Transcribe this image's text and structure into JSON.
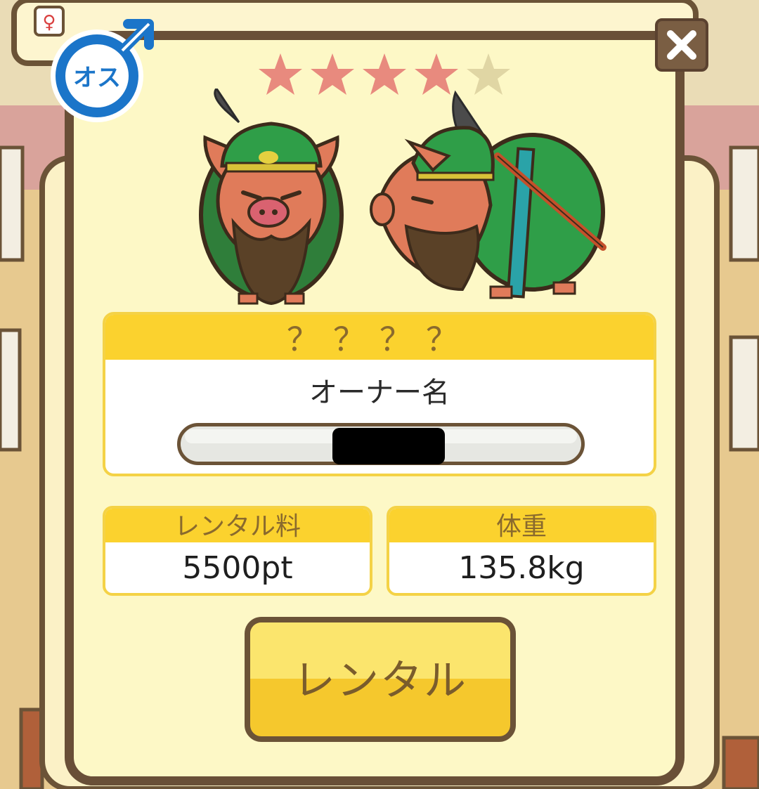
{
  "gender": {
    "label": "オス",
    "icon": "male-symbol-icon"
  },
  "close": {
    "label": "✕",
    "icon": "close-icon"
  },
  "rarity": {
    "filled": 4,
    "total": 5,
    "colors": {
      "filled": "#e88a7e",
      "empty": "#e0d6a4"
    }
  },
  "pig": {
    "name": "？？？？",
    "owner_label": "オーナー名"
  },
  "stats": {
    "rental_fee": {
      "label": "レンタル料",
      "value": "5500pt"
    },
    "weight": {
      "label": "体重",
      "value": "135.8kg"
    }
  },
  "rent_button": {
    "label": "レンタル"
  },
  "colors": {
    "panel": "#fdf8c6",
    "border": "#694f37",
    "header": "#fbd22e",
    "accent": "#f5c82d"
  }
}
